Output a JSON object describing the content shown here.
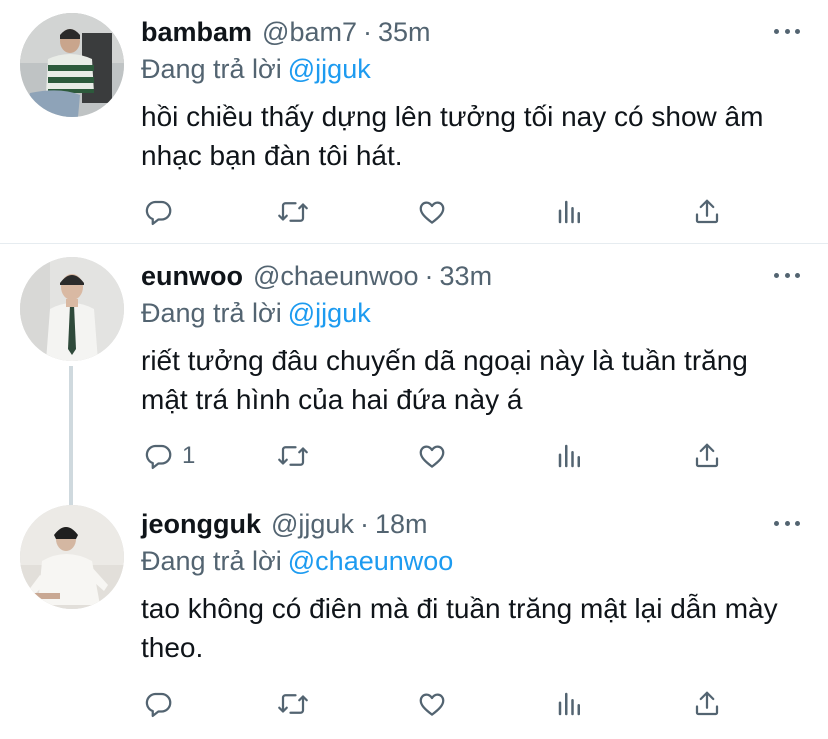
{
  "tweets": [
    {
      "name": "bambam",
      "handle": "@bam7",
      "separator": "·",
      "time": "35m",
      "reply_prefix": "Đang trả lời",
      "reply_to": "@jjguk",
      "text": "hồi chiều thấy dựng lên tưởng tối nay có show âm nhạc bạn đàn tôi hát.",
      "reply_count": ""
    },
    {
      "name": "eunwoo",
      "handle": "@chaeunwoo",
      "separator": "·",
      "time": "33m",
      "reply_prefix": "Đang trả lời",
      "reply_to": "@jjguk",
      "text": "riết tưởng đâu chuyến dã ngoại này là tuần trăng mật trá hình của hai đứa này á",
      "reply_count": "1"
    },
    {
      "name": "jeongguk",
      "handle": "@jjguk",
      "separator": "·",
      "time": "18m",
      "reply_prefix": "Đang trả lời",
      "reply_to": "@chaeunwoo",
      "text": "tao không có điên mà đi tuần trăng mật lại dẫn mày theo.",
      "reply_count": ""
    }
  ],
  "colors": {
    "text": "#0f1419",
    "secondary": "#536471",
    "link": "#1d9bf0",
    "divider": "#e6ecf0",
    "thread_line": "#cfd9de"
  },
  "icons": [
    "reply-icon",
    "retweet-icon",
    "like-icon",
    "stats-icon",
    "share-icon",
    "more-icon"
  ]
}
